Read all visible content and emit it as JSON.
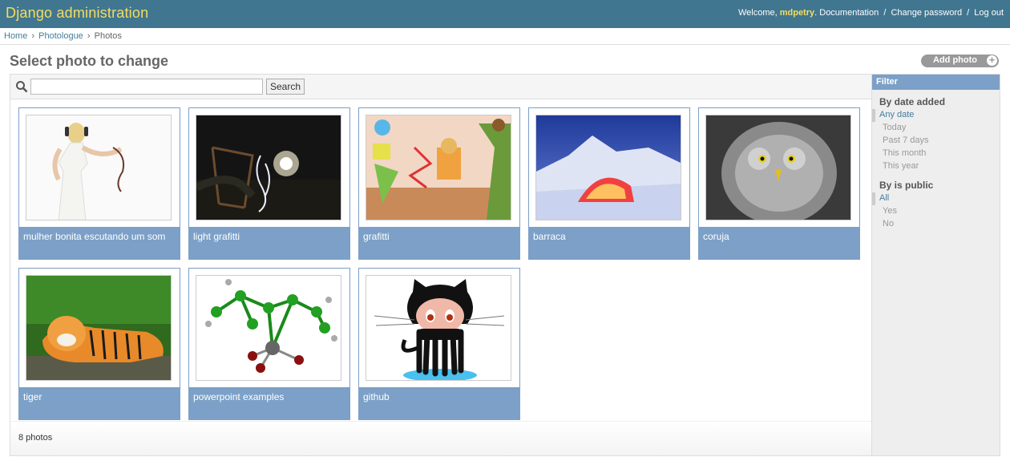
{
  "header": {
    "brand": "Django administration",
    "welcome": "Welcome,",
    "username": "mdpetry",
    "links": [
      "Documentation",
      "Change password",
      "Log out"
    ]
  },
  "breadcrumbs": [
    "Home",
    "Photologue",
    "Photos"
  ],
  "page_title": "Select photo to change",
  "add_button": "Add photo",
  "search": {
    "value": "",
    "button": "Search"
  },
  "photos": [
    {
      "title": "mulher bonita escutando um som",
      "icon": "woman-with-headphones-photo"
    },
    {
      "title": "light grafitti",
      "icon": "light-graffiti-photo"
    },
    {
      "title": "grafitti",
      "icon": "graffiti-photo"
    },
    {
      "title": "barraca",
      "icon": "tent-photo"
    },
    {
      "title": "coruja",
      "icon": "owl-photo"
    },
    {
      "title": "tiger",
      "icon": "tiger-photo"
    },
    {
      "title": "powerpoint examples",
      "icon": "molecule-photo"
    },
    {
      "title": "github",
      "icon": "octocat-photo"
    }
  ],
  "count": "8 photos",
  "filter": {
    "title": "Filter",
    "groups": [
      {
        "title": "By date added",
        "options": [
          "Any date",
          "Today",
          "Past 7 days",
          "This month",
          "This year"
        ],
        "selected": 0
      },
      {
        "title": "By is public",
        "options": [
          "All",
          "Yes",
          "No"
        ],
        "selected": 0
      }
    ]
  },
  "colors": {
    "header": "#417690",
    "brand": "#f5dd5d",
    "caption": "#7ca0c7",
    "link": "#447e9b"
  }
}
